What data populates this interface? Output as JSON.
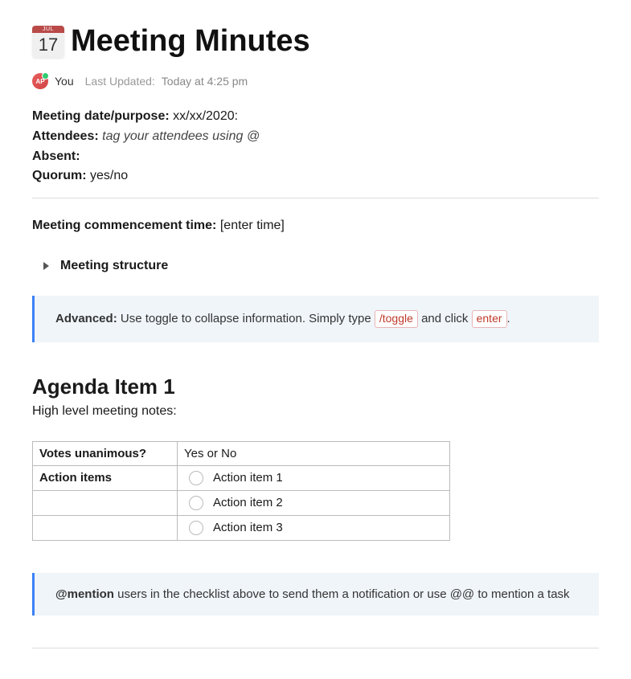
{
  "title": "Meeting Minutes",
  "calendar_icon": {
    "month": "JUL",
    "day": "17"
  },
  "byline": {
    "avatar_initials": "AP",
    "you": "You",
    "updated_label": "Last Updated:",
    "updated_value": "Today at 4:25 pm"
  },
  "meta": {
    "date_label": "Meeting date/purpose:",
    "date_value": "xx/xx/2020:",
    "attendees_label": "Attendees:",
    "attendees_value": "tag your attendees using @",
    "absent_label": "Absent:",
    "absent_value": "",
    "quorum_label": "Quorum:",
    "quorum_value": "yes/no"
  },
  "commencement": {
    "label": "Meeting commencement time:",
    "value": "[enter time]"
  },
  "toggle": {
    "label": "Meeting structure"
  },
  "callout_advanced": {
    "strong": "Advanced:",
    "text_before": "Use toggle to collapse information. Simply type ",
    "chip1": "/toggle",
    "mid": " and click ",
    "chip2": "enter",
    "after": "."
  },
  "agenda": {
    "title": "Agenda Item 1",
    "subtitle": "High level meeting notes:"
  },
  "table": {
    "votes_label": "Votes unanimous?",
    "votes_value": "Yes or No",
    "actions_label": "Action items",
    "items": [
      "Action item 1",
      "Action item 2",
      "Action item 3"
    ]
  },
  "callout_mention": {
    "strong": "@mention",
    "rest": " users in the checklist above to send them a notification or use @@ to mention a task"
  }
}
